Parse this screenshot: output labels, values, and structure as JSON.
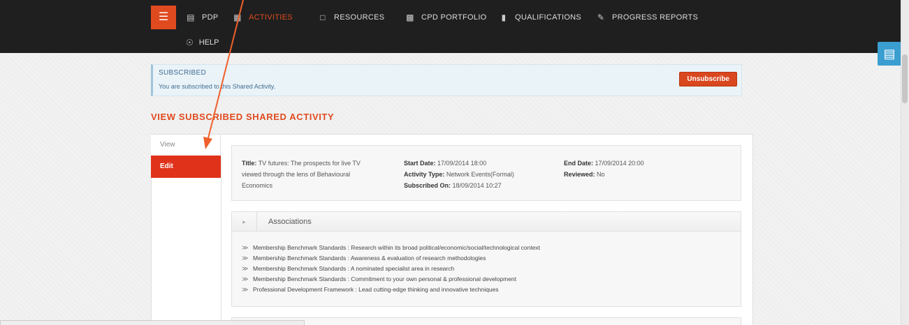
{
  "nav": {
    "menu_icon": "hamburger-icon",
    "items": [
      {
        "label": "PDP",
        "icon": "book-icon"
      },
      {
        "label": "ACTIVITIES",
        "icon": "activity-icon",
        "active": true
      },
      {
        "label": "RESOURCES",
        "icon": "folder-icon"
      },
      {
        "label": "CPD PORTFOLIO",
        "icon": "clipboard-icon"
      },
      {
        "label": "QUALIFICATIONS",
        "icon": "document-icon"
      },
      {
        "label": "PROGRESS REPORTS",
        "icon": "edit-icon"
      }
    ],
    "help": {
      "label": "HELP",
      "icon": "lifebuoy-icon"
    },
    "active_color": "#e04a1f"
  },
  "alert": {
    "title": "SUBSCRIBED",
    "message": "You are subscribed to this Shared Activity.",
    "button": "Unsubscribe"
  },
  "page_title": "VIEW SUBSCRIBED SHARED ACTIVITY",
  "tabs": {
    "view": "View",
    "edit": "Edit"
  },
  "activity": {
    "title_label": "Title:",
    "title_line1": "TV futures: The prospects for live TV",
    "title_line2": "viewed through the lens of Behavioural",
    "title_line3": "Economics",
    "start_label": "Start Date:",
    "start_value": "17/09/2014 18:00",
    "type_label": "Activity Type:",
    "type_value": "Network Events(Formal)",
    "subscribed_label": "Subscribed On:",
    "subscribed_value": "18/09/2014 10:27",
    "end_label": "End Date:",
    "end_value": "17/09/2014 20:00",
    "reviewed_label": "Reviewed:",
    "reviewed_value": "No"
  },
  "associations": {
    "heading": "Associations",
    "items": [
      "Membership Benchmark Standards : Research within its broad political/economic/social/technological context",
      "Membership Benchmark Standards : Awareness & evaluation of research methodologies",
      "Membership Benchmark Standards : A nominated specialist area in research",
      "Membership Benchmark Standards : Commitment to your own personal & professional development",
      "Professional Development Framework : Lead cutting-edge thinking and innovative techniques"
    ]
  },
  "side_tab_icon": "clipboard-icon"
}
